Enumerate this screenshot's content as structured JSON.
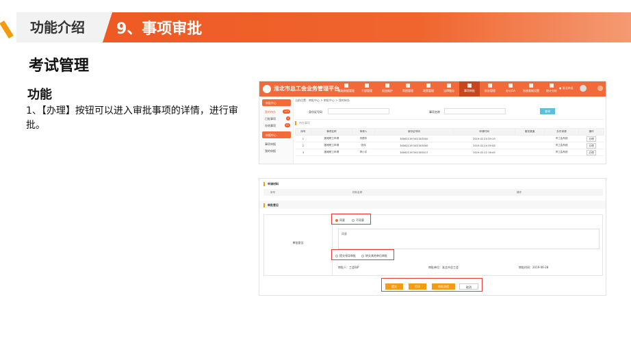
{
  "header": {
    "left_title": "功能介绍",
    "section_title": "9、事项审批"
  },
  "main": {
    "title": "考试管理",
    "subtitle": "功能",
    "description": "1、【办理】按钮可以进入审批事项的详情，进行审批。"
  },
  "shot1": {
    "brand": "淮北市总工会业务管理平台",
    "nav": [
      "基础数据管理",
      "干部管理",
      "权益维护",
      "帮困管理",
      "政策管理",
      "法律服务",
      "事项审批",
      "财务管理",
      "办公OA",
      "系统基础设置",
      "统计分析"
    ],
    "nav_active_index": 6,
    "user": "● 淮北市总",
    "side_groups": [
      {
        "title": "审批中心",
        "items": [
          {
            "label": "我的待办",
            "badge": "123",
            "current": true
          },
          {
            "label": "已批事项",
            "badge": "4",
            "current": false
          },
          {
            "label": "办结事项",
            "badge": "15",
            "current": false
          }
        ]
      },
      {
        "title": "申报中心",
        "items": [
          {
            "label": "事项申报",
            "badge": "",
            "current": false
          },
          {
            "label": "我的申报",
            "badge": "",
            "current": false
          }
        ]
      }
    ],
    "breadcrumb": "当前位置：审批中心 > 审批中心 > 我的待办",
    "search": {
      "field1_label": "身份证号码",
      "field2_label": "事项名称",
      "button": "查询"
    },
    "tab": "待办事项",
    "table": {
      "columns": [
        "序号",
        "事项名称",
        "申请人",
        "身份证号码",
        "申请时间",
        "服务渠道",
        "办件来源",
        "操作"
      ],
      "rows": [
        [
          "1",
          "困难职工申请",
          "刘德华",
          "340621197401303000",
          "2019-02-14 09:19",
          "",
          "市工会系统",
          "办理"
        ],
        [
          "2",
          "困难职工申请",
          "张伟",
          "340621197401303000",
          "2019-02-14 09:08",
          "",
          "市工会系统",
          "办理"
        ],
        [
          "3",
          "困难职工申请",
          "李小平",
          "340621197001303017",
          "2019-02-12 16:45",
          "",
          "市工会系统",
          "办理"
        ]
      ]
    }
  },
  "shot2": {
    "materials_title": "申请材料",
    "materials_columns": [
      "序号",
      "材料名称",
      "操作"
    ],
    "opinion_title": "审批意见",
    "form_label": "审批意见",
    "radios": [
      {
        "label": "同意",
        "on": true
      },
      {
        "label": "不同意",
        "on": false
      }
    ],
    "textarea_hint": "同意",
    "next_radios": [
      {
        "label": "提交领导审批",
        "on": false
      },
      {
        "label": "转交其他单位审批",
        "on": false
      }
    ],
    "info": {
      "reviewer": "审批人：工会科P",
      "unit": "审批单位：淮北市总工会",
      "time": "审批时间：2019-06-28"
    },
    "buttons": [
      "提交",
      "打印",
      "审批流程",
      "取消"
    ]
  }
}
